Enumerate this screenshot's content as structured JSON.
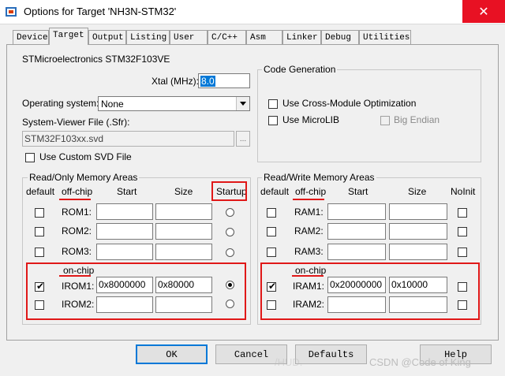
{
  "window": {
    "title": "Options for Target 'NH3N-STM32'",
    "close_glyph": "✕",
    "close_color": "#e81123"
  },
  "tabs": [
    "Device",
    "Target",
    "Output",
    "Listing",
    "User",
    "C/C++",
    "Asm",
    "Linker",
    "Debug",
    "Utilities"
  ],
  "active_tab": "Target",
  "device": {
    "name": "STMicroelectronics STM32F103VE"
  },
  "xtal": {
    "label": "Xtal (MHz):",
    "value": "8.0"
  },
  "os": {
    "label": "Operating system:",
    "value": "None"
  },
  "svd": {
    "label": "System-Viewer File (.Sfr):",
    "value": "STM32F103xx.svd",
    "browse": "...",
    "custom_label": "Use Custom SVD File"
  },
  "codegen": {
    "title": "Code Generation",
    "cross_module": "Use Cross-Module Optimization",
    "microlib": "Use MicroLIB",
    "big_endian": "Big Endian"
  },
  "rom": {
    "title": "Read/Only Memory Areas",
    "col_default": "default",
    "col_offchip": "off-chip",
    "col_start": "Start",
    "col_size": "Size",
    "col_startup": "Startup",
    "onchip_label": "on-chip",
    "rows": [
      {
        "name": "ROM1:",
        "start": "",
        "size": "",
        "default": false,
        "startup": false
      },
      {
        "name": "ROM2:",
        "start": "",
        "size": "",
        "default": false,
        "startup": false
      },
      {
        "name": "ROM3:",
        "start": "",
        "size": "",
        "default": false,
        "startup": false
      },
      {
        "name": "IROM1:",
        "start": "0x8000000",
        "size": "0x80000",
        "default": true,
        "startup": true
      },
      {
        "name": "IROM2:",
        "start": "",
        "size": "",
        "default": false,
        "startup": false
      }
    ]
  },
  "ram": {
    "title": "Read/Write Memory Areas",
    "col_default": "default",
    "col_offchip": "off-chip",
    "col_start": "Start",
    "col_size": "Size",
    "col_noinit": "NoInit",
    "onchip_label": "on-chip",
    "rows": [
      {
        "name": "RAM1:",
        "start": "",
        "size": "",
        "default": false,
        "noinit": false
      },
      {
        "name": "RAM2:",
        "start": "",
        "size": "",
        "default": false,
        "noinit": false
      },
      {
        "name": "RAM3:",
        "start": "",
        "size": "",
        "default": false,
        "noinit": false
      },
      {
        "name": "IRAM1:",
        "start": "0x20000000",
        "size": "0x10000",
        "default": true,
        "noinit": false
      },
      {
        "name": "IRAM2:",
        "start": "",
        "size": "",
        "default": false,
        "noinit": false
      }
    ]
  },
  "buttons": {
    "ok": "OK",
    "cancel": "Cancel",
    "defaults": "Defaults",
    "help": "Help"
  },
  "watermark": "CSDN @Code of King",
  "watermark_faint": "/HUD.",
  "colors": {
    "highlight_red": "#e01818",
    "selection_blue": "#0078d7"
  }
}
